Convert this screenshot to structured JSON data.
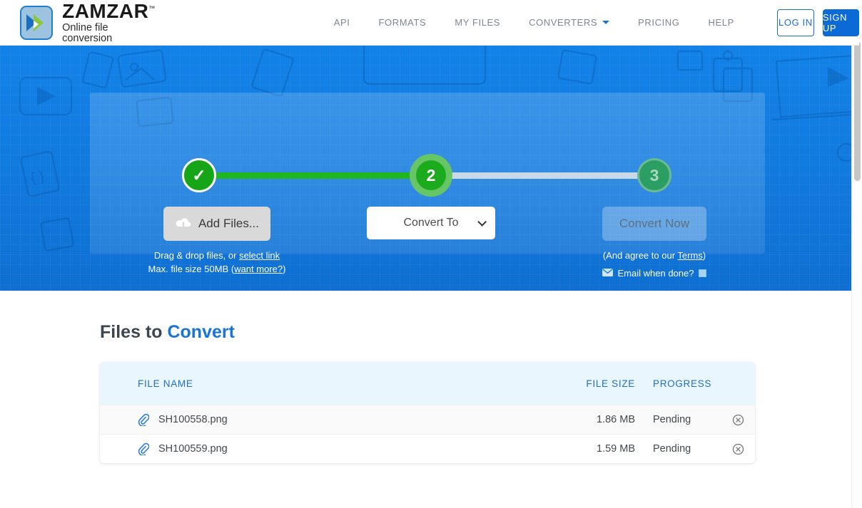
{
  "header": {
    "logo": {
      "title": "ZAMZAR",
      "tm": "™",
      "subtitle": "Online file conversion",
      "icon": "double-chevron-icon"
    },
    "nav": [
      {
        "label": "API"
      },
      {
        "label": "FORMATS"
      },
      {
        "label": "MY FILES"
      },
      {
        "label": "CONVERTERS",
        "has_caret": true
      },
      {
        "label": "PRICING"
      },
      {
        "label": "HELP"
      }
    ],
    "login_label": "LOG IN",
    "signup_label": "SIGN UP",
    "signup_color": "#0c6ad6",
    "login_color": "#1a6fd4"
  },
  "hero": {
    "steps": [
      {
        "number": "✓",
        "state": "complete"
      },
      {
        "number": "2",
        "state": "active"
      },
      {
        "number": "3",
        "state": "pending"
      }
    ],
    "step1": {
      "button_label": "Add Files...",
      "icon": "cloud-upload-icon",
      "note_prefix": "Drag & drop files, or ",
      "note_link": "select link",
      "limit_prefix": "Max. file size 50MB (",
      "limit_link": "want more?",
      "limit_suffix": ")"
    },
    "step2": {
      "select_label": "Convert To"
    },
    "step3": {
      "button_label": "Convert Now",
      "terms_prefix": "(And agree to our ",
      "terms_link": "Terms",
      "terms_suffix": ")",
      "email_label": "Email when done?",
      "email_icon": "envelope-icon",
      "email_checked": false
    },
    "accent_green": "#1fb61f",
    "track_pending": "#c8d9ea"
  },
  "files": {
    "title_prefix": "Files to ",
    "title_highlight": "Convert",
    "columns": {
      "name": "FILE NAME",
      "size": "FILE SIZE",
      "progress": "PROGRESS"
    },
    "rows": [
      {
        "icon": "paperclip-icon",
        "name": "SH100558.png",
        "size": "1.86 MB",
        "progress": "Pending",
        "action": "remove-icon"
      },
      {
        "icon": "paperclip-icon",
        "name": "SH100559.png",
        "size": "1.59 MB",
        "progress": "Pending",
        "action": "remove-icon"
      }
    ]
  }
}
